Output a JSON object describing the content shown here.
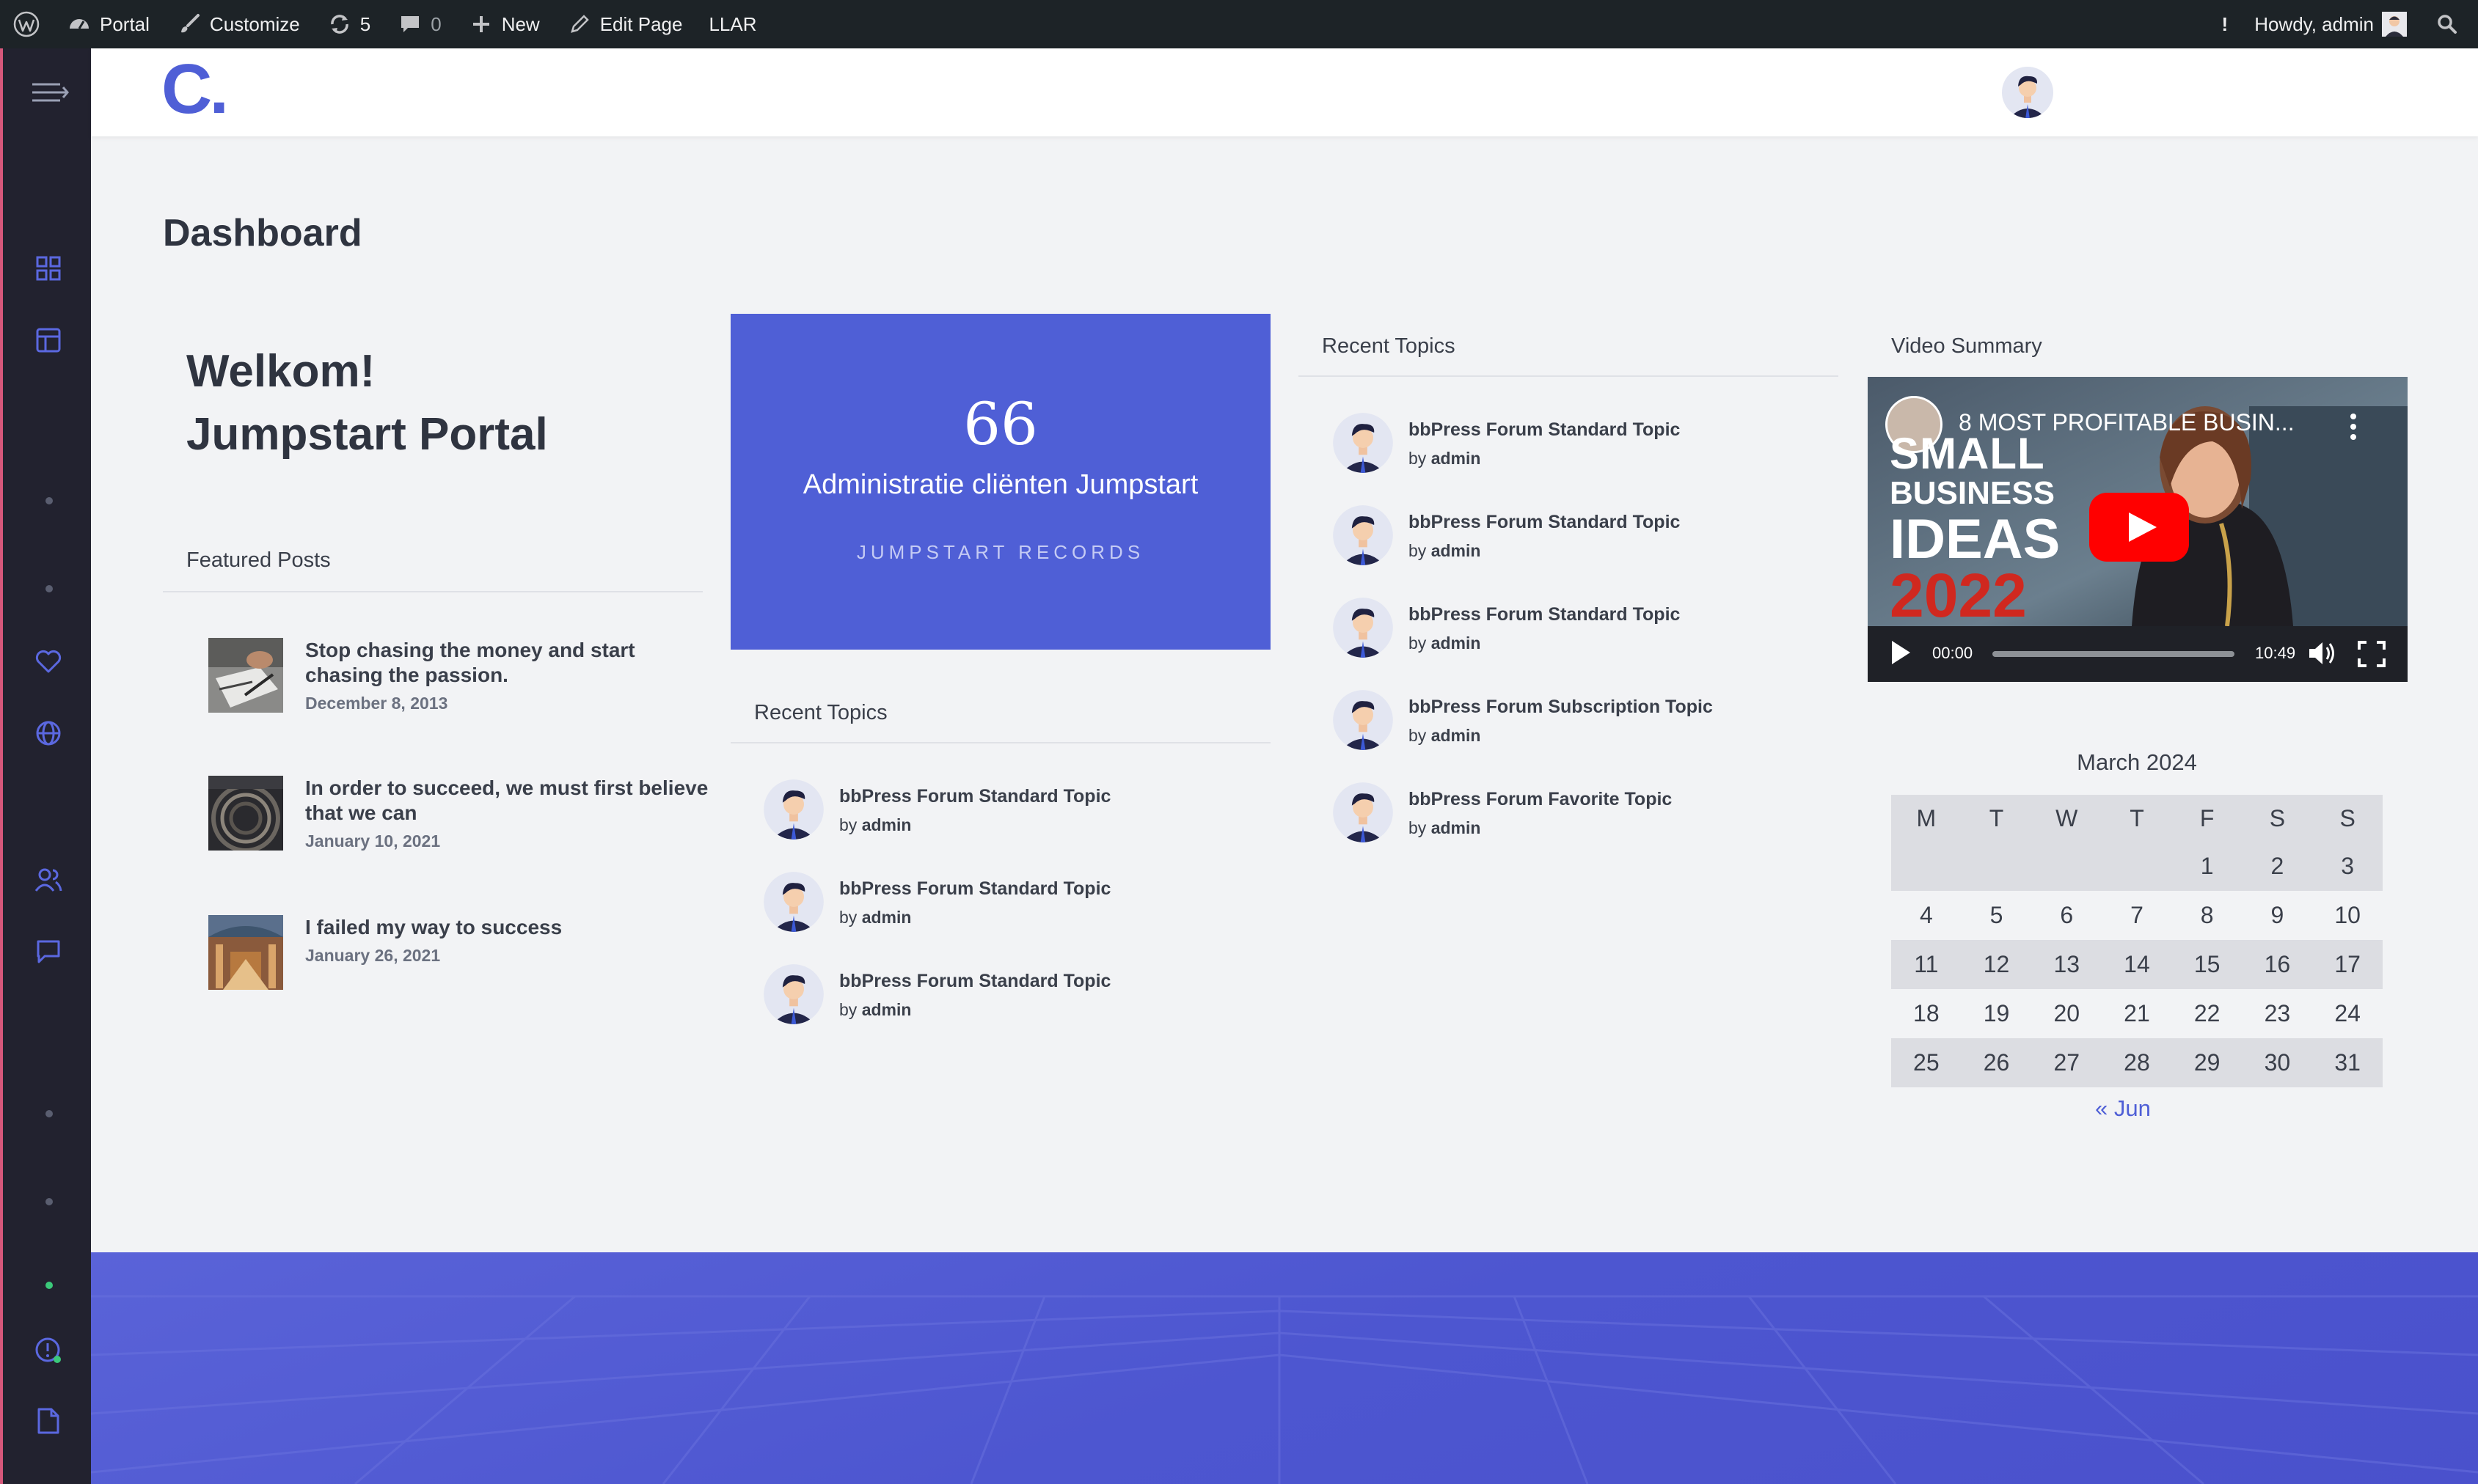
{
  "adminbar": {
    "items": [
      "Portal",
      "Customize",
      "5",
      "0",
      "New",
      "Edit Page",
      "LLAR"
    ],
    "exclamation": "!",
    "howdy": "Howdy, admin"
  },
  "header": {
    "logo": "C."
  },
  "page": {
    "title": "Dashboard"
  },
  "welcome": {
    "line1": "Welkom!",
    "line2": "Jumpstart Portal"
  },
  "featured": {
    "heading": "Featured Posts",
    "posts": [
      {
        "title": "Stop chasing the money and start chasing the passion.",
        "date": "December 8, 2013"
      },
      {
        "title": "In order to succeed, we must first believe that we can",
        "date": "January 10, 2021"
      },
      {
        "title": "I failed my way to success",
        "date": "January 26, 2021"
      }
    ]
  },
  "card": {
    "quote": "66",
    "title": "Administratie cliënten Jumpstart",
    "subtitle": "JUMPSTART RECORDS"
  },
  "recent_topics_middle": {
    "heading": "Recent Topics",
    "topics": [
      {
        "title": "bbPress Forum Standard Topic",
        "by": "by",
        "author": "admin"
      },
      {
        "title": "bbPress Forum Standard Topic",
        "by": "by",
        "author": "admin"
      },
      {
        "title": "bbPress Forum Standard Topic",
        "by": "by",
        "author": "admin"
      }
    ]
  },
  "recent_topics_right": {
    "heading": "Recent Topics",
    "topics": [
      {
        "title": "bbPress Forum Standard Topic",
        "by": "by",
        "author": "admin"
      },
      {
        "title": "bbPress Forum Standard Topic",
        "by": "by",
        "author": "admin"
      },
      {
        "title": "bbPress Forum Standard Topic",
        "by": "by",
        "author": "admin"
      },
      {
        "title": "bbPress Forum Subscription Topic",
        "by": "by",
        "author": "admin"
      },
      {
        "title": "bbPress Forum Favorite Topic",
        "by": "by",
        "author": "admin"
      }
    ]
  },
  "video": {
    "heading": "Video Summary",
    "title": "8 MOST PROFITABLE BUSIN...",
    "overlay": [
      "SMALL",
      "BUSINESS",
      "IDEAS",
      "2022"
    ],
    "current_time": "00:00",
    "duration": "10:49"
  },
  "calendar": {
    "caption": "March 2024",
    "days": [
      "M",
      "T",
      "W",
      "T",
      "F",
      "S",
      "S"
    ],
    "weeks": [
      [
        "",
        "",
        "",
        "",
        "1",
        "2",
        "3"
      ],
      [
        "4",
        "5",
        "6",
        "7",
        "8",
        "9",
        "10"
      ],
      [
        "11",
        "12",
        "13",
        "14",
        "15",
        "16",
        "17"
      ],
      [
        "18",
        "19",
        "20",
        "21",
        "22",
        "23",
        "24"
      ],
      [
        "25",
        "26",
        "27",
        "28",
        "29",
        "30",
        "31"
      ]
    ],
    "prev": "« Jun"
  },
  "colors": {
    "accent": "#4f5fd6",
    "adminbar": "#1d2327",
    "sidebar": "#22222f",
    "youtube_red": "#ff0000",
    "ideas_red": "#d0281f"
  },
  "icons": [
    "wordpress-icon",
    "dashboard-icon",
    "paintbrush-icon",
    "updates-icon",
    "comment-icon",
    "plus-icon",
    "pencil-icon",
    "search-icon",
    "menu-toggle-icon",
    "grid-icon",
    "layout-icon",
    "heart-icon",
    "globe-icon",
    "users-icon",
    "chat-icon",
    "alert-icon",
    "document-icon",
    "play-icon",
    "volume-icon",
    "fullscreen-icon",
    "kebab-icon",
    "youtube-play-icon",
    "quote-icon"
  ]
}
